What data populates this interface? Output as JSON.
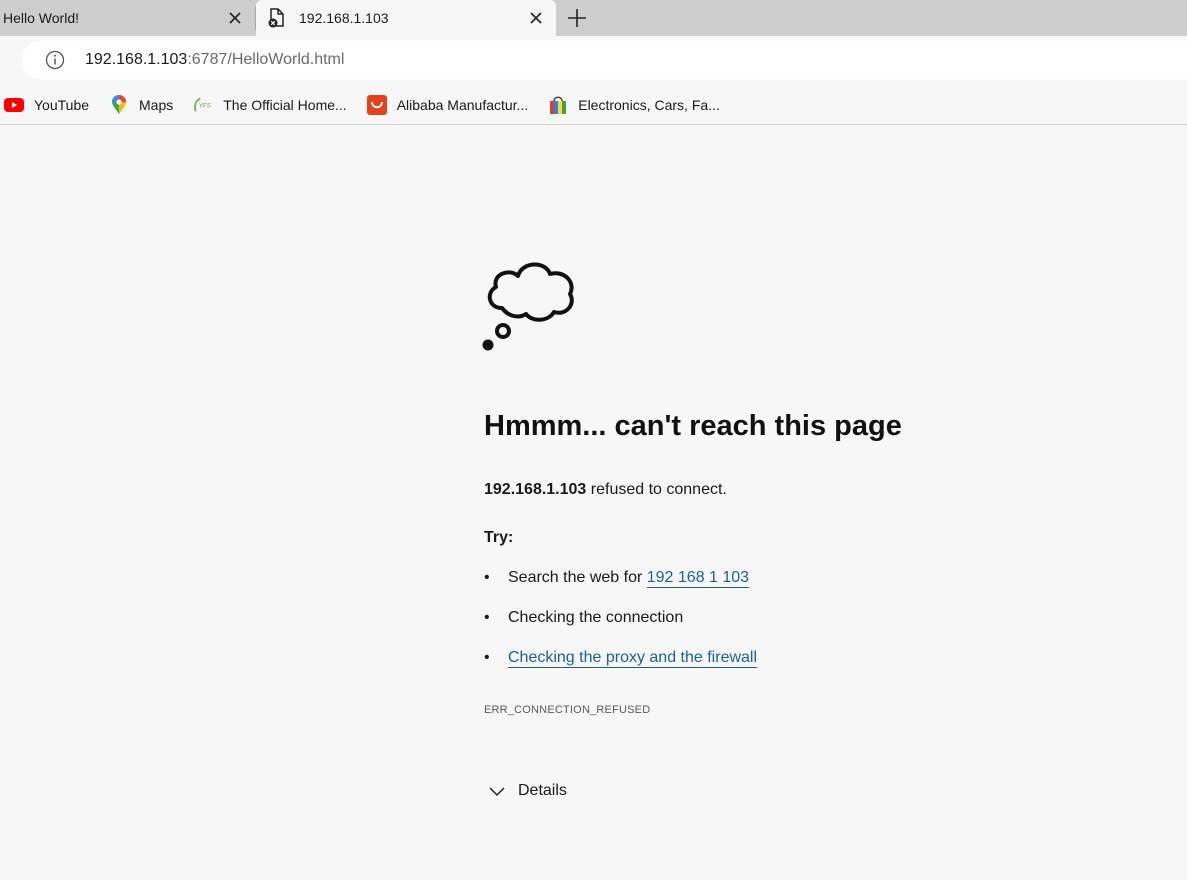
{
  "tabs": [
    {
      "title": "Hello World!",
      "active": false
    },
    {
      "title": "192.168.1.103",
      "active": true
    }
  ],
  "address": {
    "host": "192.168.1.103",
    "rest": ":6787/HelloWorld.html"
  },
  "bookmarks": [
    {
      "label": "YouTube",
      "icon": "youtube-icon"
    },
    {
      "label": "Maps",
      "icon": "maps-pin-icon"
    },
    {
      "label": "The Official Home...",
      "icon": "yfs-logo-icon"
    },
    {
      "label": "Alibaba Manufactur...",
      "icon": "alibaba-bag-icon"
    },
    {
      "label": "Electronics, Cars, Fa...",
      "icon": "shopping-bag-icon"
    }
  ],
  "error": {
    "headline": "Hmmm... can't reach this page",
    "host": "192.168.1.103",
    "message": " refused to connect.",
    "try_label": "Try:",
    "suggestion_1_prefix": "Search the web for ",
    "suggestion_1_link": "192 168 1 103",
    "suggestion_2": "Checking the connection",
    "suggestion_3_link": "Checking the proxy and the firewall",
    "code": "ERR_CONNECTION_REFUSED",
    "details_label": "Details"
  },
  "colors": {
    "link": "#1a5fa8",
    "tabstrip": "#cecece",
    "page_bg": "#f7f7f7",
    "youtube_red": "#ff0000"
  }
}
